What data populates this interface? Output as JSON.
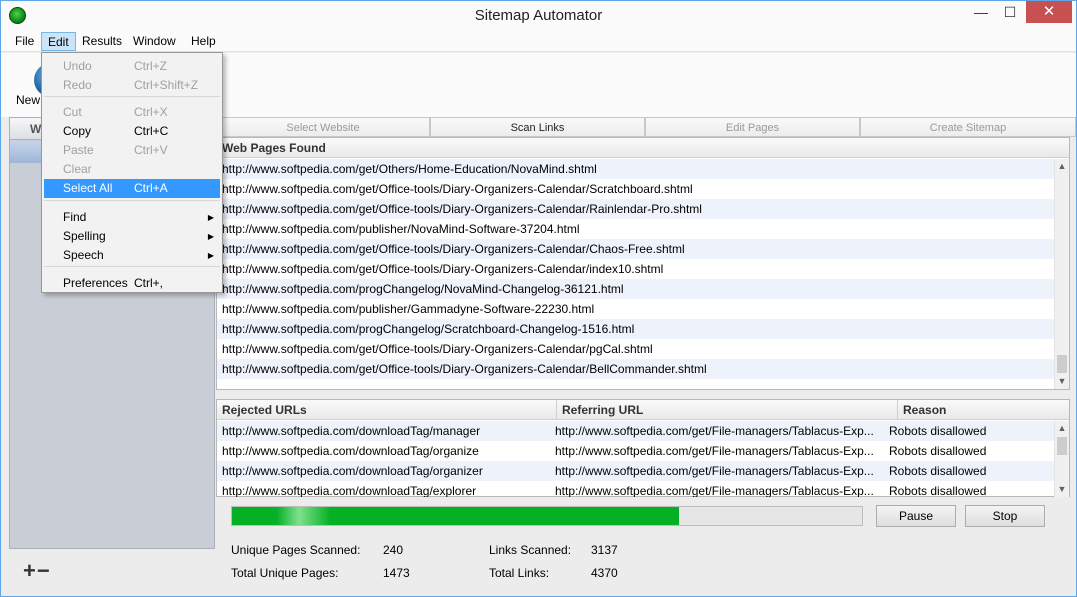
{
  "window": {
    "title": "Sitemap Automator"
  },
  "menubar": {
    "items": [
      "File",
      "Edit",
      "Results",
      "Window",
      "Help"
    ]
  },
  "toolbar": {
    "new_label": "New"
  },
  "left_panel": {
    "header_label": "W",
    "add_remove_label": "+−"
  },
  "edit_menu": {
    "items": [
      {
        "label": "Undo",
        "shortcut": "Ctrl+Z",
        "enabled": false
      },
      {
        "label": "Redo",
        "shortcut": "Ctrl+Shift+Z",
        "enabled": false
      },
      {
        "label": "Cut",
        "shortcut": "Ctrl+X",
        "enabled": false
      },
      {
        "label": "Copy",
        "shortcut": "Ctrl+C",
        "enabled": true
      },
      {
        "label": "Paste",
        "shortcut": "Ctrl+V",
        "enabled": false
      },
      {
        "label": "Clear",
        "shortcut": "",
        "enabled": false
      },
      {
        "label": "Select All",
        "shortcut": "Ctrl+A",
        "enabled": true,
        "highlighted": true
      },
      {
        "label": "Find",
        "shortcut": "",
        "enabled": true,
        "submenu": true
      },
      {
        "label": "Spelling",
        "shortcut": "",
        "enabled": true,
        "submenu": true
      },
      {
        "label": "Speech",
        "shortcut": "",
        "enabled": true,
        "submenu": true
      },
      {
        "label": "Preferences",
        "shortcut": "Ctrl+,",
        "enabled": true
      }
    ]
  },
  "tabs": [
    {
      "label": "Select Website",
      "enabled": false
    },
    {
      "label": "Scan Links",
      "enabled": true
    },
    {
      "label": "Edit Pages",
      "enabled": false
    },
    {
      "label": "Create Sitemap",
      "enabled": false
    }
  ],
  "web_pages": {
    "header": "Web Pages Found",
    "rows": [
      "http://www.softpedia.com/get/Others/Home-Education/NovaMind.shtml",
      "http://www.softpedia.com/get/Office-tools/Diary-Organizers-Calendar/Scratchboard.shtml",
      "http://www.softpedia.com/get/Office-tools/Diary-Organizers-Calendar/Rainlendar-Pro.shtml",
      "http://www.softpedia.com/publisher/NovaMind-Software-37204.html",
      "http://www.softpedia.com/get/Office-tools/Diary-Organizers-Calendar/Chaos-Free.shtml",
      "http://www.softpedia.com/get/Office-tools/Diary-Organizers-Calendar/index10.shtml",
      "http://www.softpedia.com/progChangelog/NovaMind-Changelog-36121.html",
      "http://www.softpedia.com/publisher/Gammadyne-Software-22230.html",
      "http://www.softpedia.com/progChangelog/Scratchboard-Changelog-1516.html",
      "http://www.softpedia.com/get/Office-tools/Diary-Organizers-Calendar/pgCal.shtml",
      "http://www.softpedia.com/get/Office-tools/Diary-Organizers-Calendar/BellCommander.shtml"
    ]
  },
  "rejected": {
    "columns": [
      "Rejected URLs",
      "Referring URL",
      "Reason"
    ],
    "rows": [
      [
        "http://www.softpedia.com/downloadTag/manager",
        "http://www.softpedia.com/get/File-managers/Tablacus-Exp...",
        "Robots disallowed"
      ],
      [
        "http://www.softpedia.com/downloadTag/organize",
        "http://www.softpedia.com/get/File-managers/Tablacus-Exp...",
        "Robots disallowed"
      ],
      [
        "http://www.softpedia.com/downloadTag/organizer",
        "http://www.softpedia.com/get/File-managers/Tablacus-Exp...",
        "Robots disallowed"
      ],
      [
        "http://www.softpedia.com/downloadTag/explorer",
        "http://www.softpedia.com/get/File-managers/Tablacus-Exp...",
        "Robots disallowed"
      ]
    ]
  },
  "progress": {
    "fraction": 0.71
  },
  "buttons": {
    "pause": "Pause",
    "stop": "Stop"
  },
  "stats": {
    "unique_pages_scanned_label": "Unique Pages Scanned:",
    "unique_pages_scanned": "240",
    "total_unique_pages_label": "Total Unique Pages:",
    "total_unique_pages": "1473",
    "links_scanned_label": "Links Scanned:",
    "links_scanned": "3137",
    "total_links_label": "Total Links:",
    "total_links": "4370"
  },
  "colors": {
    "accent": "#06b025",
    "menu_highlight": "#3399ff",
    "close_button": "#c75050"
  }
}
